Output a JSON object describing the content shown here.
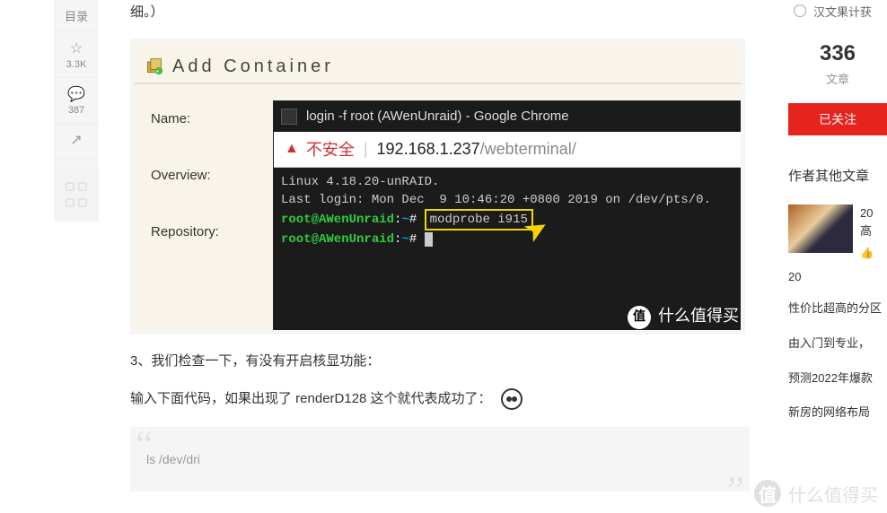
{
  "sidebar": {
    "toc": "目录",
    "likes": "3.3K",
    "comments": "387"
  },
  "article": {
    "intro_tail": "细。）",
    "step3": "3、我们检查一下，有没有开启核显功能：",
    "step3b": "输入下面代码，如果出现了 renderD128 这个就代表成功了：",
    "code1": "ls /dev/dri"
  },
  "shot": {
    "header": "Add Container",
    "labels": {
      "name": "Name:",
      "overview": "Overview:",
      "repo": "Repository:"
    },
    "chrome_title": "login -f root (AWenUnraid) - Google Chrome",
    "insecure": "不安全",
    "host": "192.168.1.237",
    "path": "/webterminal/",
    "term": {
      "l1": "Linux 4.18.20-unRAID.",
      "l2": "Last login: Mon Dec  9 10:46:20 +0800 2019 on /dev/pts/0.",
      "user": "root@AWenUnraid",
      "cwd": "~",
      "cmd": "modprobe i915"
    },
    "watermark": "什么值得买",
    "wm_char": "值"
  },
  "right": {
    "stat_text": "汉文果计获",
    "count": "336",
    "count_label": "文章",
    "follow": "已关注",
    "other_head": "作者其他文章",
    "a1_title": "20",
    "a1_title2": "高",
    "a2": "20",
    "links": [
      "性价比超高的分区",
      "由入门到专业，",
      "预测2022年爆款",
      "新房的网络布局"
    ]
  },
  "page_watermark": "什么值得买"
}
